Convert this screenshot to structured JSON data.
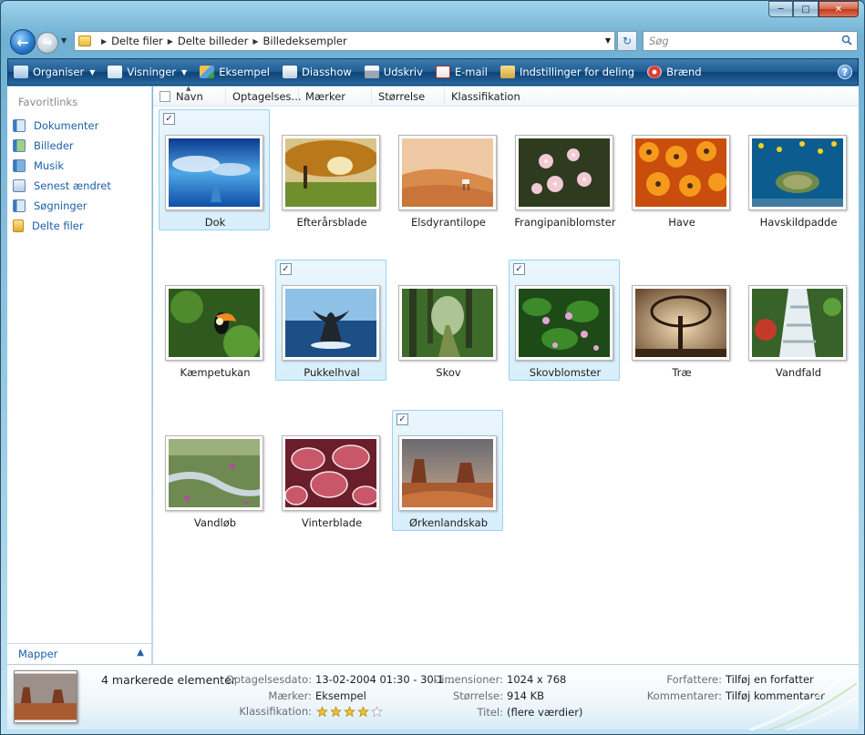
{
  "address": {
    "crumbs": [
      "Delte filer",
      "Delte billeder",
      "Billedeksempler"
    ],
    "search_placeholder": "Søg"
  },
  "toolbar": {
    "items": [
      {
        "label": "Organiser",
        "icon": "organize-icon",
        "dropdown": true
      },
      {
        "label": "Visninger",
        "icon": "views-icon",
        "dropdown": true
      },
      {
        "label": "Eksempel",
        "icon": "preview-icon",
        "dropdown": false
      },
      {
        "label": "Diasshow",
        "icon": "slideshow-icon",
        "dropdown": false
      },
      {
        "label": "Udskriv",
        "icon": "print-icon",
        "dropdown": false
      },
      {
        "label": "E-mail",
        "icon": "email-icon",
        "dropdown": false
      },
      {
        "label": "Indstillinger for deling",
        "icon": "sharing-icon",
        "dropdown": false
      },
      {
        "label": "Brænd",
        "icon": "burn-icon",
        "dropdown": false
      }
    ]
  },
  "nav": {
    "title": "Favoritlinks",
    "items": [
      "Dokumenter",
      "Billeder",
      "Musik",
      "Senest ændret",
      "Søgninger",
      "Delte filer"
    ],
    "folders_label": "Mapper"
  },
  "columns": [
    "Navn",
    "Optagelses...",
    "Mærker",
    "Størrelse",
    "Klassifikation"
  ],
  "files": [
    {
      "name": "Dok",
      "selected": true
    },
    {
      "name": "Efterårsblade",
      "selected": false
    },
    {
      "name": "Elsdyrantilope",
      "selected": false
    },
    {
      "name": "Frangipaniblomster",
      "selected": false
    },
    {
      "name": "Have",
      "selected": false
    },
    {
      "name": "Havskildpadde",
      "selected": false
    },
    {
      "name": "Kæmpetukan",
      "selected": false
    },
    {
      "name": "Pukkelhval",
      "selected": true
    },
    {
      "name": "Skov",
      "selected": false
    },
    {
      "name": "Skovblomster",
      "selected": true
    },
    {
      "name": "Træ",
      "selected": false
    },
    {
      "name": "Vandfald",
      "selected": false
    },
    {
      "name": "Vandløb",
      "selected": false
    },
    {
      "name": "Vinterblade",
      "selected": false
    },
    {
      "name": "Ørkenlandskab",
      "selected": true
    }
  ],
  "details": {
    "title": "4 markerede elementer",
    "date_label": "Optagelsesdato:",
    "date_value": "13-02-2004 01:30 - 30-1...",
    "tags_label": "Mærker:",
    "tags_value": "Eksempel",
    "rating_label": "Klassifikation:",
    "rating_stars": 4,
    "rating_max": 5,
    "dim_label": "Dimensioner:",
    "dim_value": "1024 x 768",
    "size_label": "Størrelse:",
    "size_value": "914 KB",
    "title_label": "Titel:",
    "title_value": "(flere værdier)",
    "authors_label": "Forfattere:",
    "authors_value": "Tilføj en forfatter",
    "comments_label": "Kommentarer:",
    "comments_value": "Tilføj kommentarer"
  }
}
